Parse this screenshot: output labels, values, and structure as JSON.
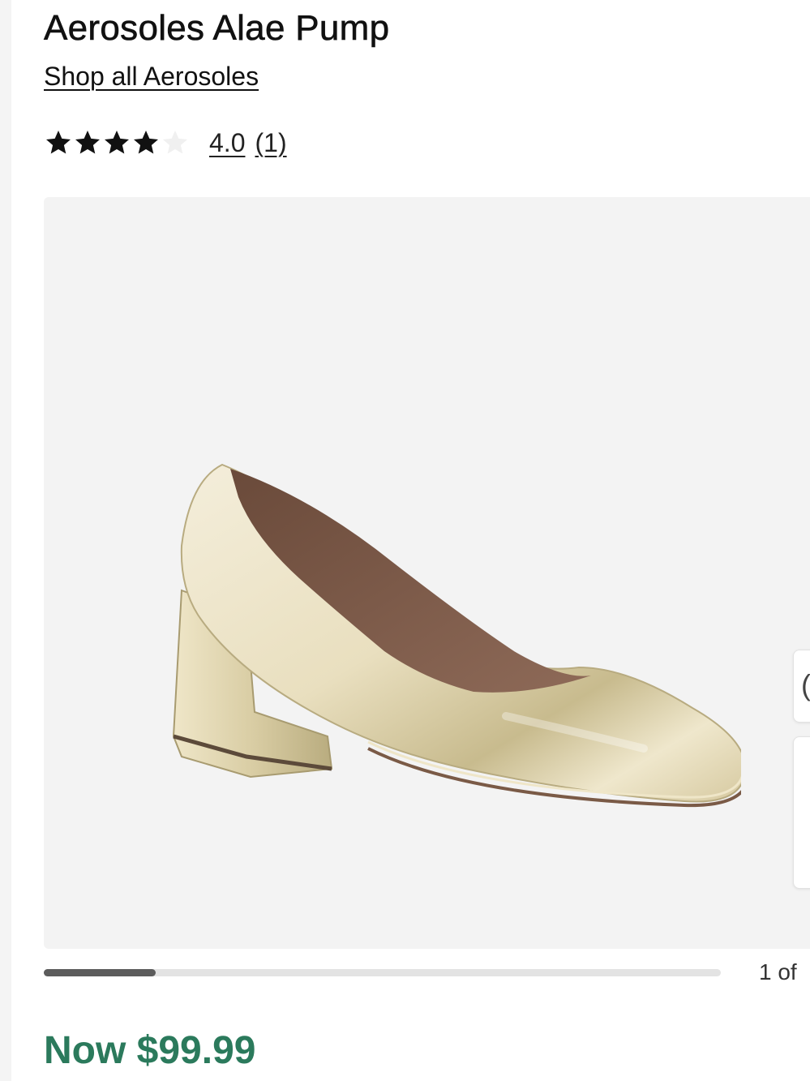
{
  "product": {
    "title": "Aerosoles Alae Pump",
    "brand_link": "Shop all Aerosoles",
    "rating": {
      "value": "4.0",
      "count": "(1)",
      "stars_filled": 4,
      "stars_total": 5
    },
    "gallery": {
      "image_name": "shoe-product-image",
      "counter": "1 of",
      "progress_fraction": 0.165,
      "side_button_glyph": "("
    },
    "price": "Now $99.99"
  },
  "colors": {
    "price": "#2b7a5c",
    "star_filled": "#111111",
    "star_empty": "#f0f0f0"
  }
}
